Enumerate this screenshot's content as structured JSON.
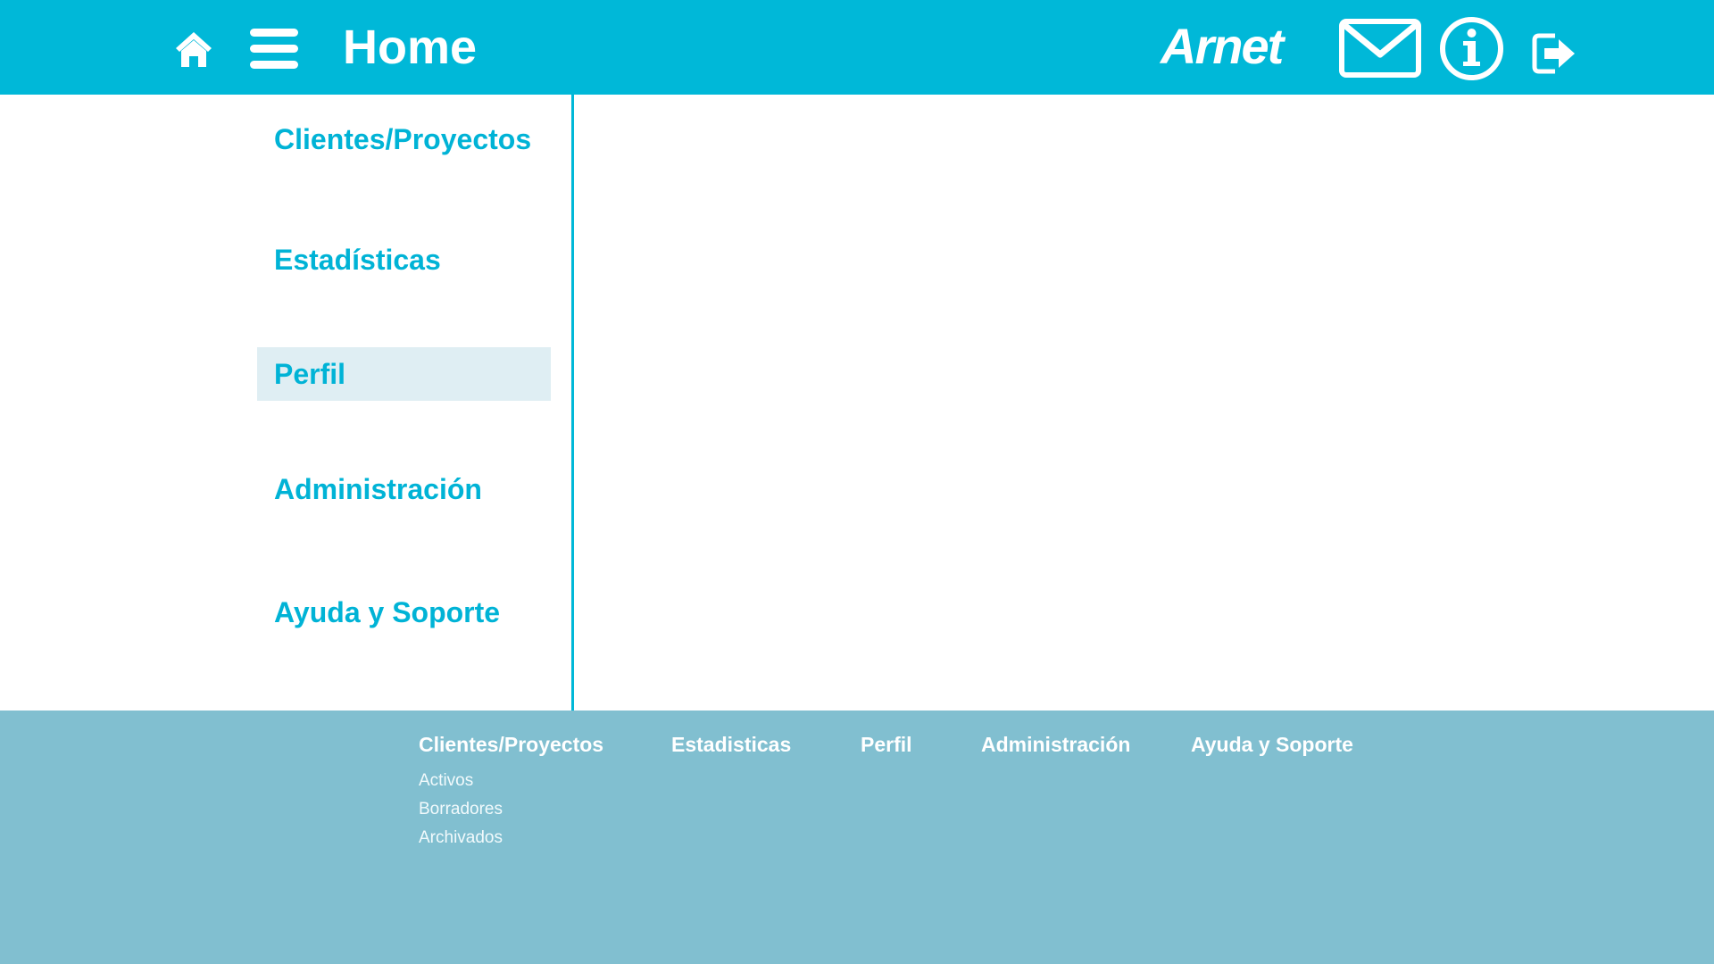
{
  "header": {
    "title": "Home",
    "brand": "Arnet",
    "icons": {
      "home": "home-icon",
      "menu": "hamburger-menu-icon",
      "mail": "mail-icon",
      "info": "info-icon",
      "logout": "logout-icon"
    }
  },
  "sidebar": {
    "items": [
      {
        "label": "Clientes/Proyectos",
        "active": false
      },
      {
        "label": "Estadísticas",
        "active": false
      },
      {
        "label": "Perfil",
        "active": true
      },
      {
        "label": "Administración",
        "active": false
      },
      {
        "label": "Ayuda y Soporte",
        "active": false
      }
    ]
  },
  "footer": {
    "columns": [
      {
        "label": "Clientes/Proyectos",
        "links": [
          "Activos",
          "Borradores",
          "Archivados"
        ]
      },
      {
        "label": "Estadisticas"
      },
      {
        "label": "Perfil"
      },
      {
        "label": "Administración"
      },
      {
        "label": "Ayuda y Soporte"
      }
    ]
  },
  "colors": {
    "primary": "#00b8d8",
    "sidebar_text": "#00b3d6",
    "active_item_bg": "#dfeef3",
    "footer_bg": "#81bfd0",
    "white": "#ffffff"
  }
}
